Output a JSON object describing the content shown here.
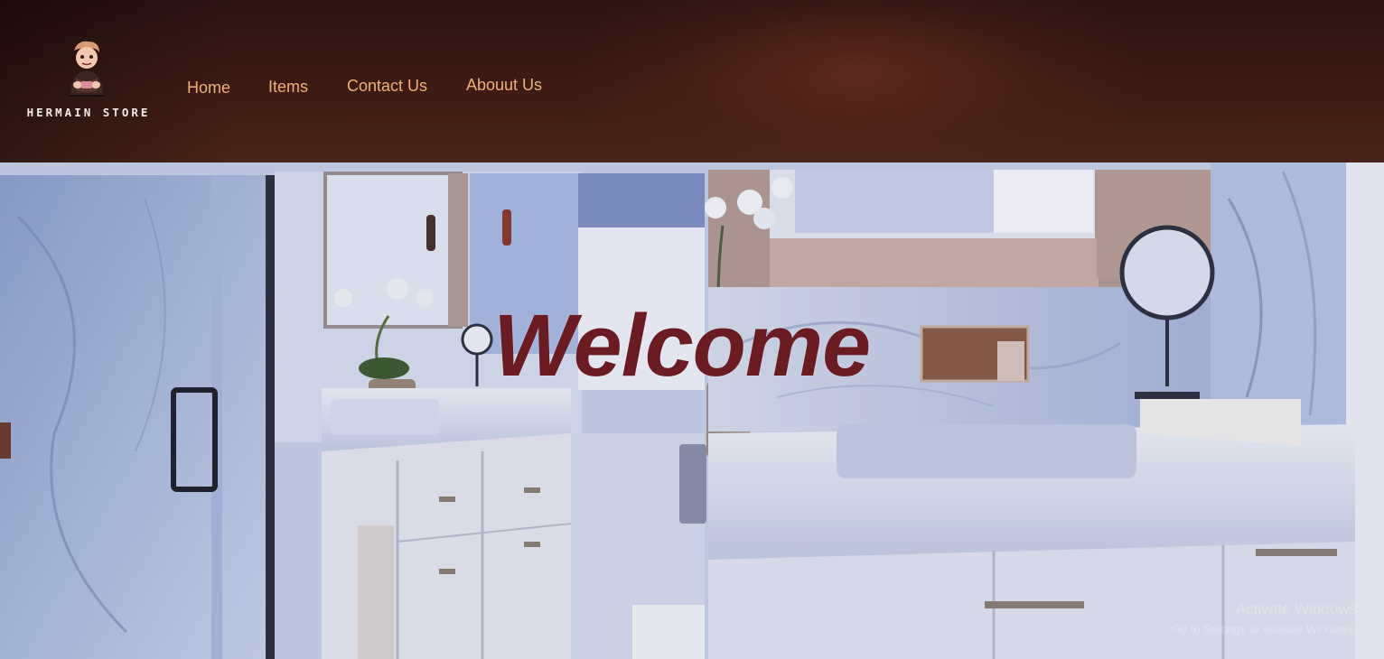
{
  "brand": {
    "name": "HERMAIN STORE",
    "logo_icon": "mascot-icon"
  },
  "nav": {
    "items": [
      {
        "label": "Home"
      },
      {
        "label": "Items"
      },
      {
        "label": "Contact Us"
      },
      {
        "label": "Abouut Us"
      }
    ]
  },
  "hero": {
    "title": "Welcome",
    "background": "bathroom-vanity-photo"
  },
  "watermark": {
    "line1": "Activate Windows",
    "line2": "Go to Settings to activate Windows."
  },
  "colors": {
    "header_bg": "#3a1a14",
    "nav_text": "#f0b07a",
    "welcome_text": "#6a1c22",
    "brand_text": "#f3e9e4"
  }
}
